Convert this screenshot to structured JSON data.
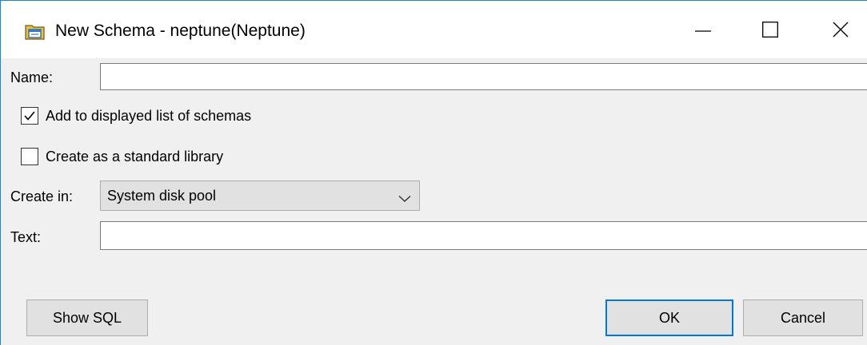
{
  "window": {
    "title": "New Schema - neptune(Neptune)"
  },
  "form": {
    "name_label": "Name:",
    "name_value": "",
    "add_to_list_label": "Add to displayed list of schemas",
    "add_to_list_checked": true,
    "standard_library_label": "Create as a standard library",
    "standard_library_checked": false,
    "create_in_label": "Create in:",
    "create_in_value": "System disk pool",
    "text_label": "Text:",
    "text_value": ""
  },
  "buttons": {
    "show_sql": "Show SQL",
    "ok": "OK",
    "cancel": "Cancel"
  },
  "icons": {
    "app": "schema-folder-icon",
    "minimize": "minimize-icon",
    "maximize": "maximize-icon",
    "close": "close-icon",
    "checkmark": "checkmark-icon",
    "dropdown": "chevron-down-icon"
  },
  "colors": {
    "accent": "#0078d7",
    "window_border": "#1883d7",
    "dialog_bg": "#f0f0f0",
    "button_bg": "#e1e1e1"
  }
}
